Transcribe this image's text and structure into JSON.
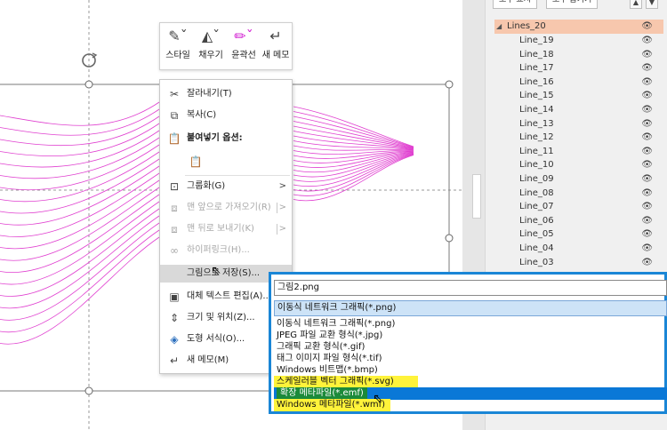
{
  "mini_toolbar": {
    "buttons": [
      {
        "label": "스타일",
        "icon": "style-icon"
      },
      {
        "label": "채우기",
        "icon": "fill-icon"
      },
      {
        "label": "윤곽선",
        "icon": "outline-icon"
      },
      {
        "label": "새 메모",
        "icon": "new-comment-icon"
      }
    ]
  },
  "context_menu": {
    "cut": "잘라내기(T)",
    "copy": "복사(C)",
    "paste_options": "붙여넣기 옵션:",
    "group": "그룹화(G)",
    "bring_front": "맨 앞으로 가져오기(R)",
    "send_back": "맨 뒤로 보내기(K)",
    "hyperlink": "하이퍼링크(H)...",
    "save_as_picture": "그림으로 저장(S)...",
    "alt_text": "대체 텍스트 편집(A)...",
    "size_position": "크기 및 위치(Z)...",
    "format_shape": "도형 서식(O)...",
    "new_comment": "새 메모(M)",
    "submenu_arrow": ">"
  },
  "selection_pane": {
    "show_all": "모두 표시",
    "hide_all": "모두 숨기기",
    "group_name": "Lines_20",
    "items": [
      "Line_19",
      "Line_18",
      "Line_17",
      "Line_16",
      "Line_15",
      "Line_14",
      "Line_13",
      "Line_12",
      "Line_11",
      "Line_10",
      "Line_09",
      "Line_08",
      "Line_07",
      "Line_06",
      "Line_05",
      "Line_04",
      "Line_03"
    ],
    "eye_glyph": "👁"
  },
  "save_dialog": {
    "filename": "그림2.png",
    "selected_type": "이동식 네트워크 그래픽(*.png)",
    "options": [
      "이동식 네트워크 그래픽(*.png)",
      "JPEG 파일 교환 형식(*.jpg)",
      "그래픽 교환 형식(*.gif)",
      "태그 이미지 파일 형식(*.tif)",
      "Windows 비트맵(*.bmp)",
      "스케일러블 벡터 그래픽(*.svg)",
      "확장 메타파일(*.emf)",
      "Windows 메타파일(*.wmf)"
    ]
  },
  "colors": {
    "lines": "#e040d0",
    "accent": "#1a86d6",
    "highlight": "#fff33a",
    "selected_row": "#0a78d7",
    "group_row": "#f7c7ad"
  }
}
